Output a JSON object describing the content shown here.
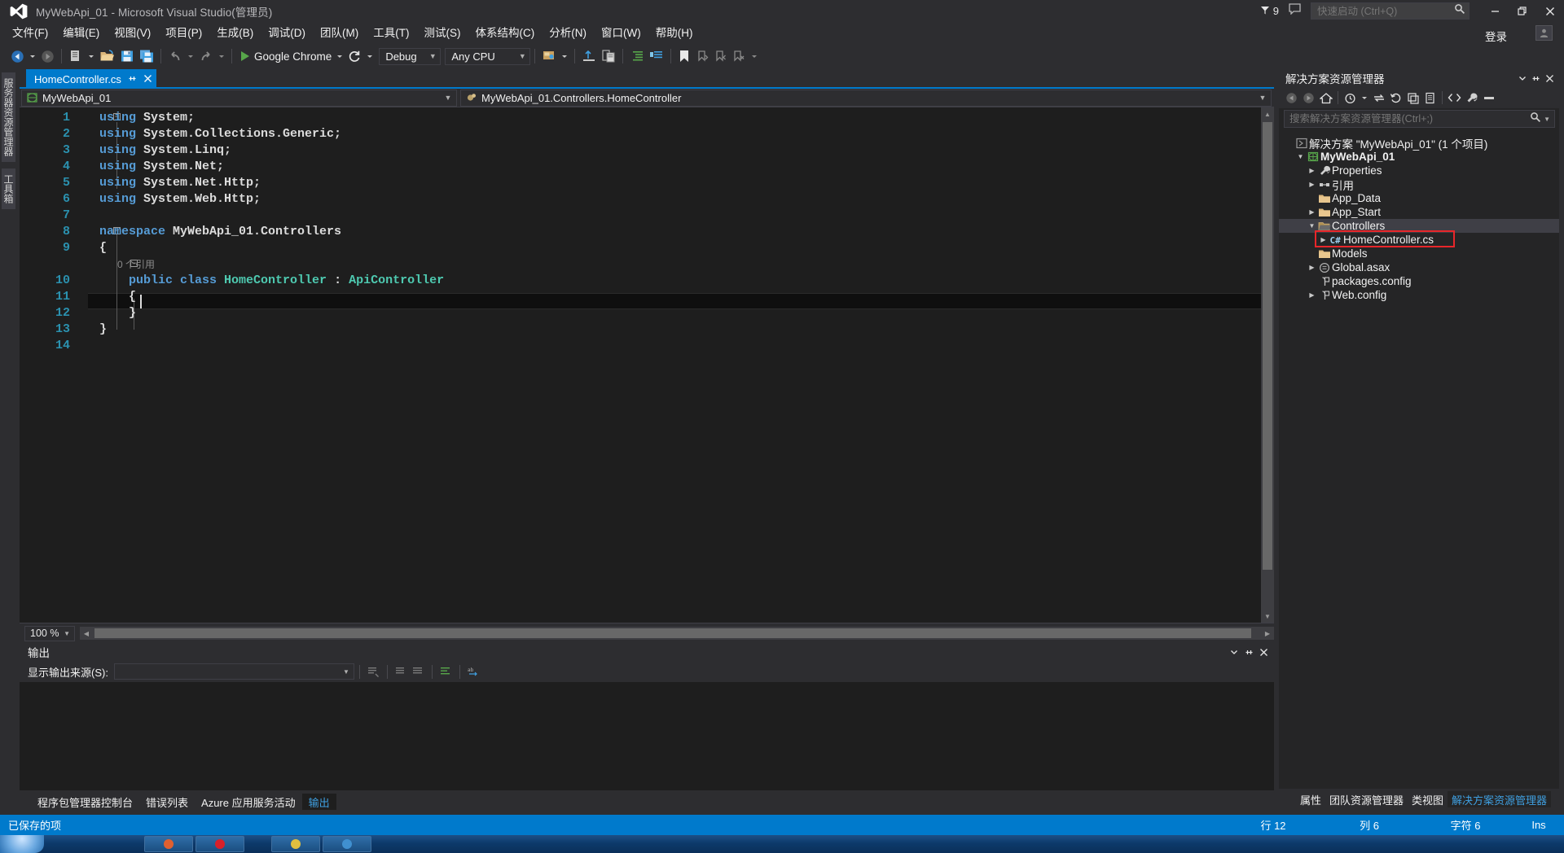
{
  "titlebar": {
    "app_title": "MyWebApi_01 - Microsoft Visual Studio(管理员)",
    "logo_name": "visual-studio-logo",
    "notification_count": "9",
    "quick_launch_placeholder": "快速启动 (Ctrl+Q)",
    "minimize": "—",
    "restore": "❐",
    "close": "✕"
  },
  "menubar": {
    "items": [
      {
        "label": "文件(F)"
      },
      {
        "label": "编辑(E)"
      },
      {
        "label": "视图(V)"
      },
      {
        "label": "项目(P)"
      },
      {
        "label": "生成(B)"
      },
      {
        "label": "调试(D)"
      },
      {
        "label": "团队(M)"
      },
      {
        "label": "工具(T)"
      },
      {
        "label": "测试(S)"
      },
      {
        "label": "体系结构(C)"
      },
      {
        "label": "分析(N)"
      },
      {
        "label": "窗口(W)"
      },
      {
        "label": "帮助(H)"
      }
    ],
    "signin_label": "登录"
  },
  "toolbar": {
    "run_target": "Google Chrome",
    "configuration": "Debug",
    "platform": "Any CPU"
  },
  "editor": {
    "tab_label": "HomeController.cs",
    "tab_pin": "⊹",
    "tab_close": "✕",
    "project_combo": "MyWebApi_01",
    "member_combo": "MyWebApi_01.Controllers.HomeController",
    "zoom_level": "100 %",
    "reference_lens": "0 个引用",
    "lines": [
      {
        "n": "1",
        "segments": [
          {
            "t": "using ",
            "c": "kw"
          },
          {
            "t": "System;",
            "c": "plain"
          }
        ]
      },
      {
        "n": "2",
        "segments": [
          {
            "t": "using ",
            "c": "kw"
          },
          {
            "t": "System.Collections.Generic;",
            "c": "plain"
          }
        ]
      },
      {
        "n": "3",
        "segments": [
          {
            "t": "using ",
            "c": "kw"
          },
          {
            "t": "System.Linq;",
            "c": "plain"
          }
        ]
      },
      {
        "n": "4",
        "segments": [
          {
            "t": "using ",
            "c": "kw"
          },
          {
            "t": "System.Net;",
            "c": "plain"
          }
        ]
      },
      {
        "n": "5",
        "segments": [
          {
            "t": "using ",
            "c": "kw"
          },
          {
            "t": "System.Net.Http;",
            "c": "plain"
          }
        ]
      },
      {
        "n": "6",
        "segments": [
          {
            "t": "using ",
            "c": "kw"
          },
          {
            "t": "System.Web.Http;",
            "c": "plain"
          }
        ]
      },
      {
        "n": "7",
        "segments": []
      },
      {
        "n": "8",
        "segments": [
          {
            "t": "namespace ",
            "c": "kw"
          },
          {
            "t": "MyWebApi_01.Controllers",
            "c": "plain"
          }
        ]
      },
      {
        "n": "9",
        "segments": [
          {
            "t": "{",
            "c": "punc"
          }
        ]
      },
      {
        "n": "10",
        "segments": [
          {
            "t": "    public class ",
            "c": "kw"
          },
          {
            "t": "HomeController",
            "c": "type"
          },
          {
            "t": " : ",
            "c": "punc"
          },
          {
            "t": "ApiController",
            "c": "type"
          }
        ]
      },
      {
        "n": "11",
        "segments": [
          {
            "t": "    {",
            "c": "punc"
          }
        ]
      },
      {
        "n": "12",
        "segments": [
          {
            "t": "    }",
            "c": "punc"
          }
        ]
      },
      {
        "n": "13",
        "segments": [
          {
            "t": "}",
            "c": "punc"
          }
        ]
      },
      {
        "n": "14",
        "segments": []
      }
    ]
  },
  "output_panel": {
    "title": "输出",
    "source_label": "显示输出来源(S):",
    "source_value": "",
    "content": "",
    "tabs": [
      {
        "label": "程序包管理器控制台",
        "active": false
      },
      {
        "label": "错误列表",
        "active": false
      },
      {
        "label": "Azure 应用服务活动",
        "active": false
      },
      {
        "label": "输出",
        "active": true
      }
    ]
  },
  "solution_explorer": {
    "title": "解决方案资源管理器",
    "search_placeholder": "搜索解决方案资源管理器(Ctrl+;)",
    "tree": [
      {
        "indent": 0,
        "expander": "",
        "icon": "solution-icon",
        "label": "解决方案 \"MyWebApi_01\" (1 个项目)",
        "bold": false,
        "selected": false,
        "highlighted": false
      },
      {
        "indent": 1,
        "expander": "▲",
        "icon": "web-project-icon",
        "label": "MyWebApi_01",
        "bold": true,
        "selected": false,
        "highlighted": false
      },
      {
        "indent": 2,
        "expander": "▶",
        "icon": "wrench-icon",
        "label": "Properties",
        "bold": false,
        "selected": false,
        "highlighted": false
      },
      {
        "indent": 2,
        "expander": "▶",
        "icon": "references-icon",
        "label": "引用",
        "bold": false,
        "selected": false,
        "highlighted": false
      },
      {
        "indent": 2,
        "expander": "",
        "icon": "folder-icon",
        "label": "App_Data",
        "bold": false,
        "selected": false,
        "highlighted": false
      },
      {
        "indent": 2,
        "expander": "▶",
        "icon": "folder-icon",
        "label": "App_Start",
        "bold": false,
        "selected": false,
        "highlighted": false
      },
      {
        "indent": 2,
        "expander": "▲",
        "icon": "folder-open-icon",
        "label": "Controllers",
        "bold": false,
        "selected": true,
        "highlighted": false
      },
      {
        "indent": 3,
        "expander": "▶",
        "icon": "csharp-file-icon",
        "label": "HomeController.cs",
        "bold": false,
        "selected": false,
        "highlighted": true
      },
      {
        "indent": 2,
        "expander": "",
        "icon": "folder-icon",
        "label": "Models",
        "bold": false,
        "selected": false,
        "highlighted": false
      },
      {
        "indent": 2,
        "expander": "▶",
        "icon": "asax-icon",
        "label": "Global.asax",
        "bold": false,
        "selected": false,
        "highlighted": false
      },
      {
        "indent": 2,
        "expander": "",
        "icon": "config-icon",
        "label": "packages.config",
        "bold": false,
        "selected": false,
        "highlighted": false
      },
      {
        "indent": 2,
        "expander": "▶",
        "icon": "config-icon",
        "label": "Web.config",
        "bold": false,
        "selected": false,
        "highlighted": false
      }
    ],
    "panel_tabs": [
      {
        "label": "属性",
        "active": false
      },
      {
        "label": "团队资源管理器",
        "active": false
      },
      {
        "label": "类视图",
        "active": false
      },
      {
        "label": "解决方案资源管理器",
        "active": true
      }
    ]
  },
  "left_dock": {
    "tabs": [
      {
        "label": "服务器资源管理器"
      },
      {
        "label": "工具箱"
      }
    ]
  },
  "statusbar": {
    "message": "已保存的项",
    "line": "行 12",
    "column": "列 6",
    "character": "字符 6",
    "insert_mode": "Ins"
  },
  "colors": {
    "accent": "#007acc",
    "chrome": "#2d2d30",
    "editor_bg": "#1e1e1e",
    "highlight_red": "#e8262a",
    "keyword_blue": "#569cd6",
    "type_teal": "#4ec9b0",
    "linenum_blue": "#2b91af"
  }
}
